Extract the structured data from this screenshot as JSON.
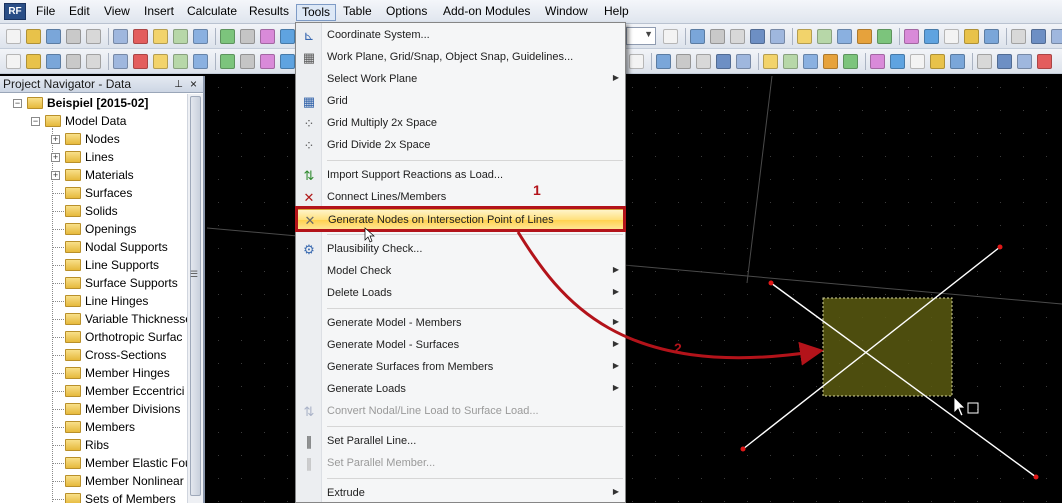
{
  "app": {
    "logo_text": "RF"
  },
  "menubar": {
    "items": [
      {
        "label": "File",
        "active": false
      },
      {
        "label": "Edit",
        "active": false
      },
      {
        "label": "View",
        "active": false
      },
      {
        "label": "Insert",
        "active": false
      },
      {
        "label": "Calculate",
        "active": false
      },
      {
        "label": "Results",
        "active": false
      },
      {
        "label": "Tools",
        "active": true
      },
      {
        "label": "Table",
        "active": false
      },
      {
        "label": "Options",
        "active": false
      },
      {
        "label": "Add-on Modules",
        "active": false
      },
      {
        "label": "Window",
        "active": false
      },
      {
        "label": "Help",
        "active": false
      }
    ]
  },
  "navigator": {
    "title": "Project Navigator - Data",
    "pin_icon": "pin-icon",
    "close_icon": "close-icon",
    "project": "Beispiel [2015-02]",
    "model_data": "Model Data",
    "items": [
      {
        "label": "Nodes",
        "expandable": true
      },
      {
        "label": "Lines",
        "expandable": true
      },
      {
        "label": "Materials",
        "expandable": true
      },
      {
        "label": "Surfaces",
        "expandable": false
      },
      {
        "label": "Solids",
        "expandable": false
      },
      {
        "label": "Openings",
        "expandable": false
      },
      {
        "label": "Nodal Supports",
        "expandable": false
      },
      {
        "label": "Line Supports",
        "expandable": false
      },
      {
        "label": "Surface Supports",
        "expandable": false
      },
      {
        "label": "Line Hinges",
        "expandable": false
      },
      {
        "label": "Variable Thicknesse",
        "expandable": false
      },
      {
        "label": "Orthotropic Surfac",
        "expandable": false
      },
      {
        "label": "Cross-Sections",
        "expandable": false
      },
      {
        "label": "Member Hinges",
        "expandable": false
      },
      {
        "label": "Member Eccentrici",
        "expandable": false
      },
      {
        "label": "Member Divisions",
        "expandable": false
      },
      {
        "label": "Members",
        "expandable": false
      },
      {
        "label": "Ribs",
        "expandable": false
      },
      {
        "label": "Member Elastic Fou",
        "expandable": false
      },
      {
        "label": "Member Nonlinear",
        "expandable": false
      },
      {
        "label": "Sets of Members",
        "expandable": false
      }
    ]
  },
  "tools_menu": {
    "items": [
      {
        "type": "item",
        "label": "Coordinate System...",
        "icon": "coordinate-system-icon",
        "submenu": false,
        "disabled": false
      },
      {
        "type": "item",
        "label": "Work Plane, Grid/Snap, Object Snap, Guidelines...",
        "icon": "work-plane-icon",
        "submenu": false,
        "disabled": false
      },
      {
        "type": "item",
        "label": "Select Work Plane",
        "icon": "",
        "submenu": true,
        "disabled": false
      },
      {
        "type": "item",
        "label": "Grid",
        "icon": "grid-icon",
        "submenu": false,
        "disabled": false
      },
      {
        "type": "item",
        "label": "Grid Multiply 2x Space",
        "icon": "grid-multiply-icon",
        "submenu": false,
        "disabled": false
      },
      {
        "type": "item",
        "label": "Grid Divide 2x Space",
        "icon": "grid-divide-icon",
        "submenu": false,
        "disabled": false
      },
      {
        "type": "sep"
      },
      {
        "type": "item",
        "label": "Import Support Reactions as Load...",
        "icon": "import-reactions-icon",
        "submenu": false,
        "disabled": false
      },
      {
        "type": "item",
        "label": "Connect Lines/Members",
        "icon": "connect-lines-icon",
        "submenu": false,
        "disabled": false
      },
      {
        "type": "item",
        "label": "Generate Nodes on Intersection Point of Lines",
        "icon": "intersection-nodes-icon",
        "submenu": false,
        "disabled": false,
        "highlighted": true
      },
      {
        "type": "sep"
      },
      {
        "type": "item",
        "label": "Plausibility Check...",
        "icon": "plausibility-check-icon",
        "submenu": false,
        "disabled": false
      },
      {
        "type": "item",
        "label": "Model Check",
        "icon": "",
        "submenu": true,
        "disabled": false
      },
      {
        "type": "item",
        "label": "Delete Loads",
        "icon": "",
        "submenu": true,
        "disabled": false
      },
      {
        "type": "sep"
      },
      {
        "type": "item",
        "label": "Generate Model - Members",
        "icon": "",
        "submenu": true,
        "disabled": false
      },
      {
        "type": "item",
        "label": "Generate Model - Surfaces",
        "icon": "",
        "submenu": true,
        "disabled": false
      },
      {
        "type": "item",
        "label": "Generate Surfaces from Members",
        "icon": "",
        "submenu": true,
        "disabled": false
      },
      {
        "type": "item",
        "label": "Generate Loads",
        "icon": "",
        "submenu": true,
        "disabled": false
      },
      {
        "type": "item",
        "label": "Convert Nodal/Line Load to Surface Load...",
        "icon": "convert-load-icon",
        "submenu": false,
        "disabled": true
      },
      {
        "type": "sep"
      },
      {
        "type": "item",
        "label": "Set Parallel Line...",
        "icon": "parallel-line-icon",
        "submenu": false,
        "disabled": false
      },
      {
        "type": "item",
        "label": "Set Parallel Member...",
        "icon": "parallel-member-icon",
        "submenu": false,
        "disabled": true
      },
      {
        "type": "sep"
      },
      {
        "type": "item",
        "label": "Extrude",
        "icon": "",
        "submenu": true,
        "disabled": false
      }
    ]
  },
  "annotations": {
    "step1": "1",
    "step2": "2"
  },
  "colors": {
    "accent_red": "#b3131a",
    "highlight_yellow": "#ffe07a",
    "selection_fill": "#5b5a10",
    "node_red": "#e01818"
  }
}
